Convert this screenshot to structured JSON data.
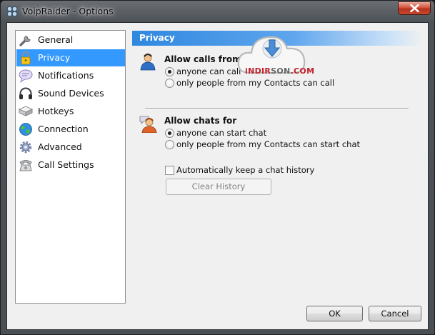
{
  "window": {
    "title": "VoipRaider - Options",
    "icons": {
      "app": "voipraider-logo-icon",
      "close": "close-icon"
    }
  },
  "sidebar": {
    "selected": "Privacy",
    "items": [
      {
        "label": "General",
        "icon": "wrench-icon"
      },
      {
        "label": "Privacy",
        "icon": "padlock-icon"
      },
      {
        "label": "Notifications",
        "icon": "speech-bubble-icon"
      },
      {
        "label": "Sound Devices",
        "icon": "headset-icon"
      },
      {
        "label": "Hotkeys",
        "icon": "keyboard-key-icon"
      },
      {
        "label": "Connection",
        "icon": "globe-icon"
      },
      {
        "label": "Advanced",
        "icon": "gear-icon"
      },
      {
        "label": "Call Settings",
        "icon": "phone-icon"
      }
    ]
  },
  "panel": {
    "header": "Privacy",
    "calls": {
      "title": "Allow calls from",
      "icon": "user-call-icon",
      "options": [
        "anyone can call",
        "only people from my Contacts can call"
      ],
      "selected": "anyone can call"
    },
    "chats": {
      "title": "Allow chats for",
      "icon": "user-chat-icon",
      "options": [
        "anyone can start chat",
        "only people from my Contacts can start chat"
      ],
      "selected": "anyone can start chat"
    },
    "history": {
      "checkbox_label": "Automatically keep a chat history",
      "checked": false,
      "clear_button": "Clear History"
    }
  },
  "footer": {
    "ok": "OK",
    "cancel": "Cancel"
  },
  "watermark": {
    "brand_a": "iNDIR",
    "brand_b": "SON",
    "brand_c": ".COM",
    "icon": "cloud-download-icon"
  },
  "colors": {
    "selection": "#3399ff",
    "header_blue": "#2f88df",
    "close_red": "#c94a30"
  }
}
